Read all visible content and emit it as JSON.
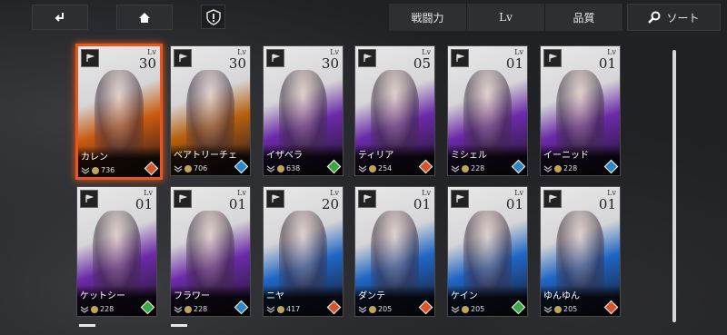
{
  "toolbar": {
    "back_icon": "back-arrow-icon",
    "home_icon": "home-icon",
    "alert_icon": "exclamation-shield-icon"
  },
  "sort": {
    "power_label": "戦闘力",
    "level_label": "Lv",
    "quality_label": "品質",
    "sort_label": "ソート"
  },
  "lv_tag": "Lv",
  "cards": [
    {
      "name": "カレン",
      "level": "30",
      "power": "736",
      "bg": "#c85a10",
      "element_color": "#d9532a",
      "selected": true
    },
    {
      "name": "ベアトリーチェ",
      "level": "30",
      "power": "706",
      "bg": "#b8600d",
      "element_color": "#2e86c8",
      "selected": false
    },
    {
      "name": "イザベラ",
      "level": "30",
      "power": "638",
      "bg": "#6b2aa8",
      "element_color": "#3fa542",
      "selected": false
    },
    {
      "name": "ティリア",
      "level": "05",
      "power": "254",
      "bg": "#6b2aa8",
      "element_color": "#d9532a",
      "selected": false
    },
    {
      "name": "ミシェル",
      "level": "01",
      "power": "228",
      "bg": "#6b2aa8",
      "element_color": "#2e86c8",
      "selected": false
    },
    {
      "name": "イーニッド",
      "level": "01",
      "power": "228",
      "bg": "#6b2aa8",
      "element_color": "#2e86c8",
      "selected": false
    },
    {
      "name": "ケットシー",
      "level": "01",
      "power": "228",
      "bg": "#6b2aa8",
      "element_color": "#3fa542",
      "selected": false
    },
    {
      "name": "フラワー",
      "level": "01",
      "power": "228",
      "bg": "#6b2aa8",
      "element_color": "#2e86c8",
      "selected": false
    },
    {
      "name": "ニヤ",
      "level": "20",
      "power": "417",
      "bg": "#1f66c4",
      "element_color": "#d9532a",
      "selected": false
    },
    {
      "name": "ダンテ",
      "level": "01",
      "power": "205",
      "bg": "#1f66c4",
      "element_color": "#d9532a",
      "selected": false
    },
    {
      "name": "ケイン",
      "level": "01",
      "power": "205",
      "bg": "#1f66c4",
      "element_color": "#3fa542",
      "selected": false
    },
    {
      "name": "ゆんゆん",
      "level": "01",
      "power": "205",
      "bg": "#1f66c4",
      "element_color": "#d9532a",
      "selected": false
    }
  ]
}
